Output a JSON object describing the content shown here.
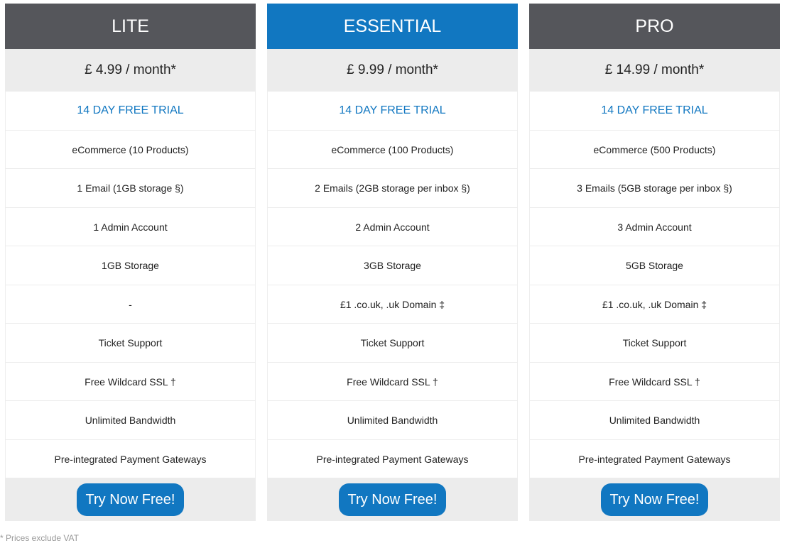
{
  "colors": {
    "header_default": "#55565b",
    "header_highlight": "#1177c1",
    "accent": "#1177c1",
    "band": "#ececec"
  },
  "plans": [
    {
      "name": "LITE",
      "price": "£ 4.99 / month*",
      "trial": "14 DAY FREE TRIAL",
      "features": [
        "eCommerce (10 Products)",
        "1 Email (1GB storage §)",
        "1 Admin Account",
        "1GB Storage",
        "-",
        "Ticket Support",
        "Free Wildcard SSL †",
        "Unlimited Bandwidth",
        "Pre-integrated Payment Gateways"
      ],
      "cta": "Try Now Free!"
    },
    {
      "name": "ESSENTIAL",
      "price": "£ 9.99 / month*",
      "trial": "14 DAY FREE TRIAL",
      "features": [
        "eCommerce (100 Products)",
        "2 Emails (2GB storage per inbox §)",
        "2 Admin Account",
        "3GB Storage",
        "£1 .co.uk, .uk  Domain ‡",
        "Ticket Support",
        "Free Wildcard SSL †",
        "Unlimited Bandwidth",
        "Pre-integrated Payment Gateways"
      ],
      "cta": "Try Now Free!"
    },
    {
      "name": "PRO",
      "price": "£ 14.99 / month*",
      "trial": "14 DAY FREE TRIAL",
      "features": [
        "eCommerce (500 Products)",
        "3 Emails (5GB storage per inbox §)",
        "3 Admin Account",
        "5GB Storage",
        "£1 .co.uk, .uk  Domain ‡",
        "Ticket Support",
        "Free Wildcard SSL †",
        "Unlimited Bandwidth",
        "Pre-integrated Payment Gateways"
      ],
      "cta": "Try Now Free!"
    }
  ],
  "footnote": "* Prices exclude VAT"
}
